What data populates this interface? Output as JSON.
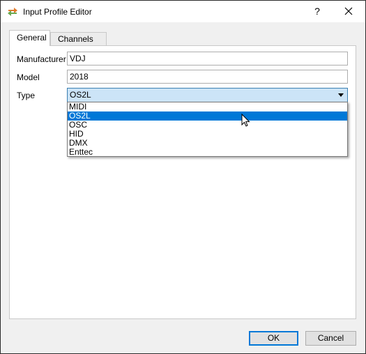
{
  "window": {
    "title": "Input Profile Editor",
    "help_label": "?"
  },
  "tabs": [
    {
      "label": "General",
      "active": true
    },
    {
      "label": "Channels",
      "active": false
    }
  ],
  "form": {
    "manufacturer_label": "Manufacturer",
    "manufacturer_value": "VDJ",
    "model_label": "Model",
    "model_value": "2018",
    "type_label": "Type",
    "type_value": "OS2L"
  },
  "type_options": [
    "MIDI",
    "OS2L",
    "OSC",
    "HID",
    "DMX",
    "Enttec"
  ],
  "type_selected_index": 1,
  "buttons": {
    "ok_label": "OK",
    "cancel_label": "Cancel"
  },
  "colors": {
    "accent": "#0078d7",
    "combo_background": "#cce4f7"
  }
}
